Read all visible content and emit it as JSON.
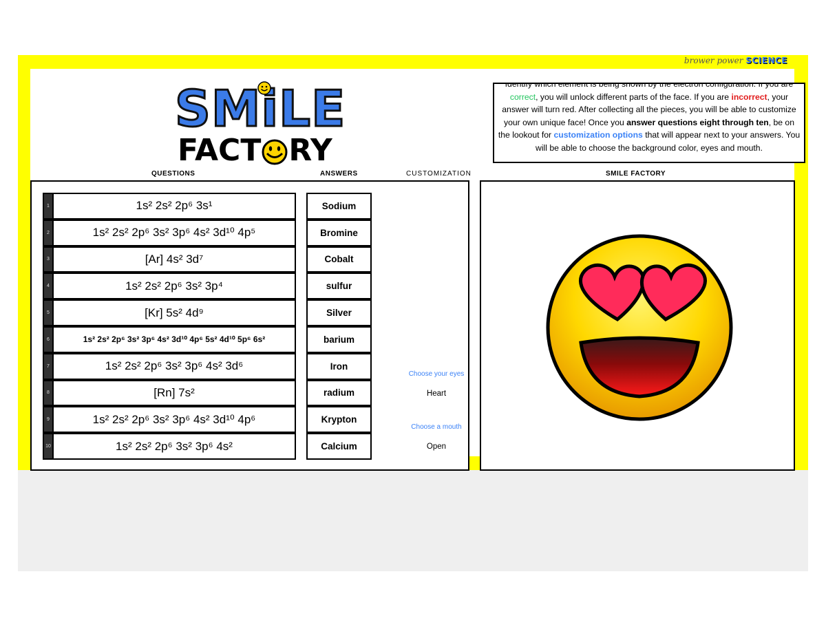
{
  "brand": {
    "text": "brower power",
    "accent": "SCIENCE"
  },
  "logo": {
    "line1": "SMiLE",
    "line2_a": "FACT",
    "line2_b": "RY"
  },
  "instructions": {
    "s1": "Identify which element is being shown by the electron configuration.  If you are ",
    "correct": "correct",
    "s2": ", you will  unlock different parts of the face.  If you are ",
    "incorrect": "incorrect",
    "s3": ", your answer will turn red. After collecting all the pieces, you will be able to customize your own unique face!  Once you ",
    "answer": "answer questions eight through ten",
    "s4": ", be on the lookout for ",
    "custom": "customization options",
    "s5": " that will appear next to your answers. You will be able to choose the background color, eyes and mouth."
  },
  "headers": {
    "questions": "QUESTIONS",
    "answers": "ANSWERS",
    "customization": "CUSTOMIZATION",
    "factory": "SMILE FACTORY"
  },
  "questions": [
    {
      "n": "1",
      "html": "1s² 2s² 2p⁶ 3s¹",
      "answer": "Sodium"
    },
    {
      "n": "2",
      "html": "1s² 2s² 2p⁶ 3s² 3p⁶ 4s² 3d¹⁰ 4p⁵",
      "answer": "Bromine"
    },
    {
      "n": "3",
      "html": "[Ar] 4s² 3d⁷",
      "answer": "Cobalt"
    },
    {
      "n": "4",
      "html": "1s² 2s² 2p⁶ 3s² 3p⁴",
      "answer": "sulfur"
    },
    {
      "n": "5",
      "html": "[Kr] 5s² 4d⁹",
      "answer": "Silver"
    },
    {
      "n": "6",
      "html": "1s² 2s² 2p⁶ 3s² 3p⁶ 4s² 3d¹⁰ 4p⁶ 5s² 4d¹⁰ 5p⁶ 6s²",
      "answer": "barium"
    },
    {
      "n": "7",
      "html": "1s² 2s² 2p⁶ 3s² 3p⁶ 4s² 3d⁶",
      "answer": "Iron"
    },
    {
      "n": "8",
      "html": "[Rn] 7s²",
      "answer": "radium"
    },
    {
      "n": "9",
      "html": "1s² 2s² 2p⁶ 3s² 3p⁶ 4s² 3d¹⁰ 4p⁶",
      "answer": "Krypton"
    },
    {
      "n": "10",
      "html": "1s² 2s² 2p⁶ 3s² 3p⁶ 4s²",
      "answer": "Calcium"
    }
  ],
  "customization": {
    "eyes_label": "Choose your eyes",
    "eyes_value": "Heart",
    "mouth_label": "Choose a mouth",
    "mouth_value": "Open"
  },
  "colors": {
    "sheet": "#ffff00",
    "accent_blue": "#3b82f6",
    "correct_green": "#22c55e",
    "incorrect_red": "#e11d1d"
  }
}
